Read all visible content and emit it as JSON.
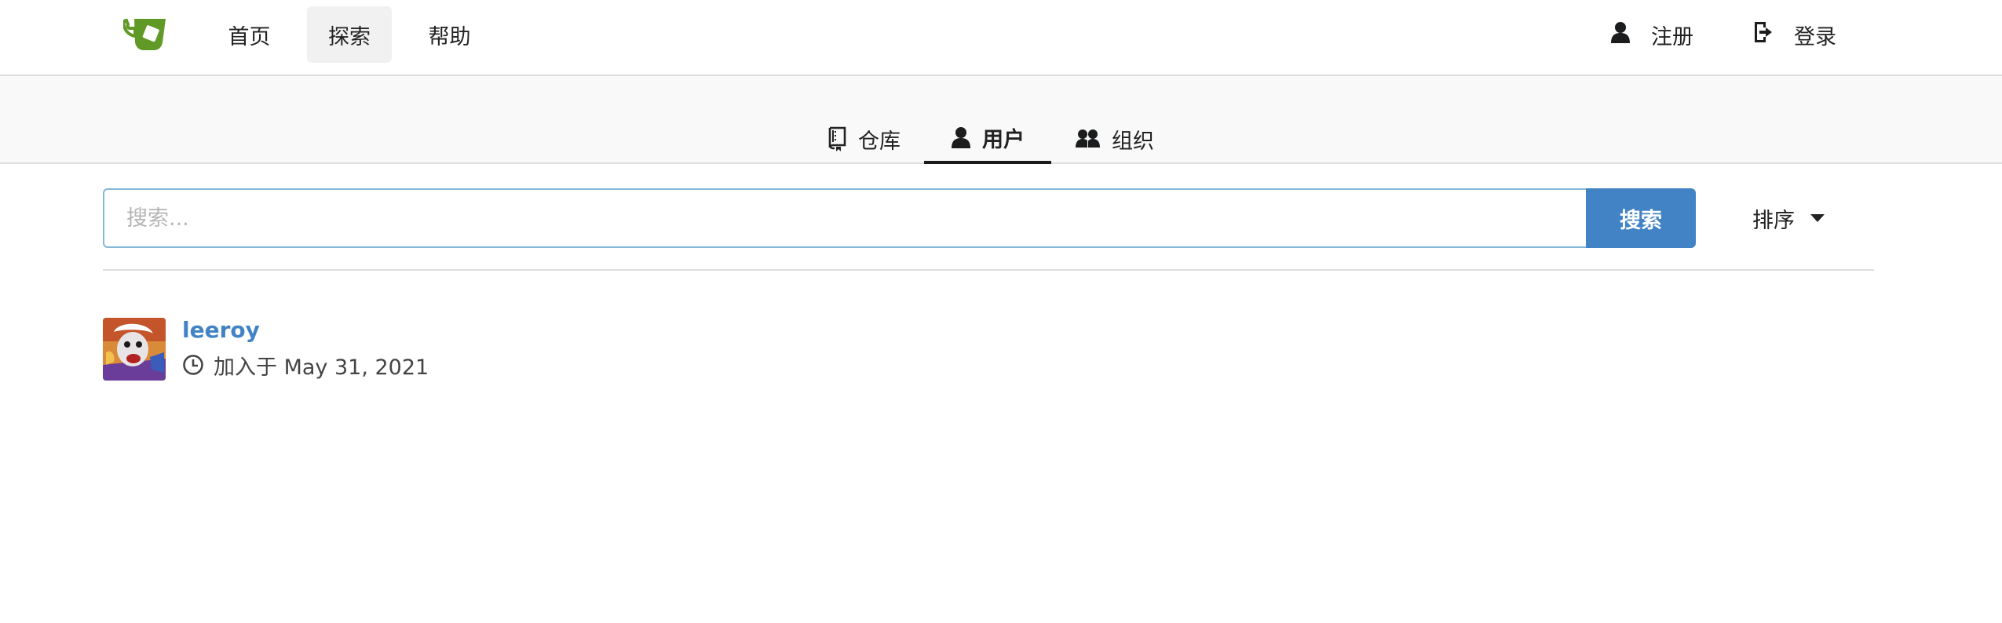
{
  "navbar": {
    "items": [
      {
        "label": "首页"
      },
      {
        "label": "探索"
      },
      {
        "label": "帮助"
      }
    ],
    "register_label": "注册",
    "login_label": "登录"
  },
  "explore_tabs": [
    {
      "label": "仓库",
      "icon": "repo-icon"
    },
    {
      "label": "用户",
      "icon": "person-icon"
    },
    {
      "label": "组织",
      "icon": "organization-icon"
    }
  ],
  "search": {
    "placeholder": "搜索...",
    "value": "",
    "button_label": "搜索",
    "sort_label": "排序"
  },
  "users": [
    {
      "username": "leeroy",
      "joined": "加入于 May 31, 2021",
      "icon": "clock-icon"
    }
  ],
  "colors": {
    "accent": "#4183c4",
    "logo_green": "#609926",
    "input_border": "#85b7d9",
    "tabbar_bg": "#f9f9f9"
  }
}
